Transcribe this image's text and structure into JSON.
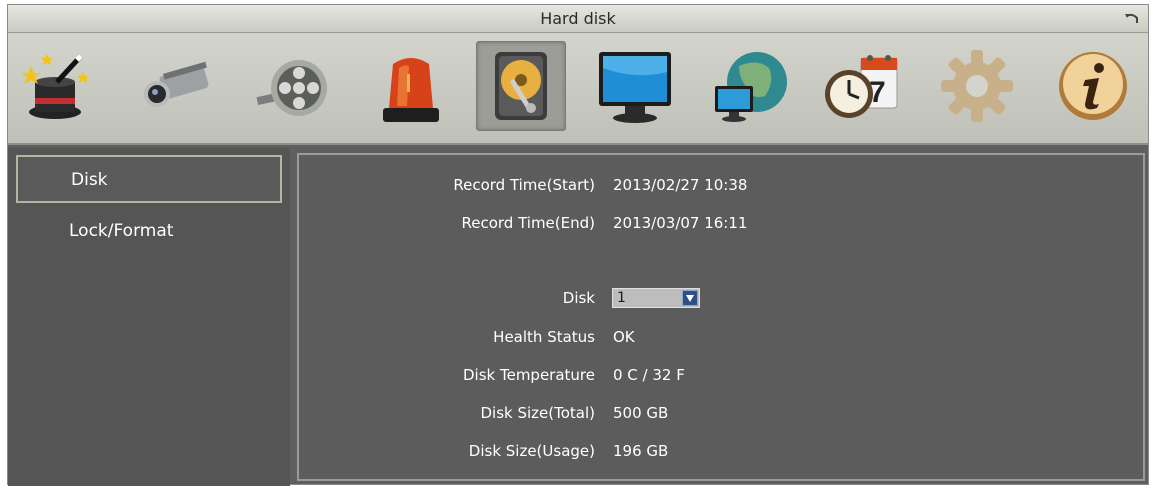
{
  "window": {
    "title": "Hard disk"
  },
  "toolbar": {
    "icons": [
      {
        "name": "wizard-icon"
      },
      {
        "name": "camera-icon"
      },
      {
        "name": "record-icon"
      },
      {
        "name": "alarm-icon"
      },
      {
        "name": "hard-disk-icon",
        "selected": true
      },
      {
        "name": "display-icon"
      },
      {
        "name": "network-icon"
      },
      {
        "name": "schedule-icon"
      },
      {
        "name": "settings-gear-icon"
      },
      {
        "name": "info-icon"
      }
    ],
    "schedule_calendar_day": "7"
  },
  "menu": {
    "items": [
      {
        "label": "Disk",
        "active": true
      },
      {
        "label": "Lock/Format",
        "active": false
      }
    ]
  },
  "disk_info": {
    "record_start_label": "Record Time(Start)",
    "record_start_value": "2013/02/27  10:38",
    "record_end_label": "Record Time(End)",
    "record_end_value": "2013/03/07  16:11",
    "disk_label": "Disk",
    "disk_value": "1",
    "health_label": "Health Status",
    "health_value": "OK",
    "temp_label": "Disk Temperature",
    "temp_value": "0 C / 32 F",
    "size_total_label": "Disk Size(Total)",
    "size_total_value": "500 GB",
    "size_usage_label": "Disk Size(Usage)",
    "size_usage_value": "196 GB"
  }
}
